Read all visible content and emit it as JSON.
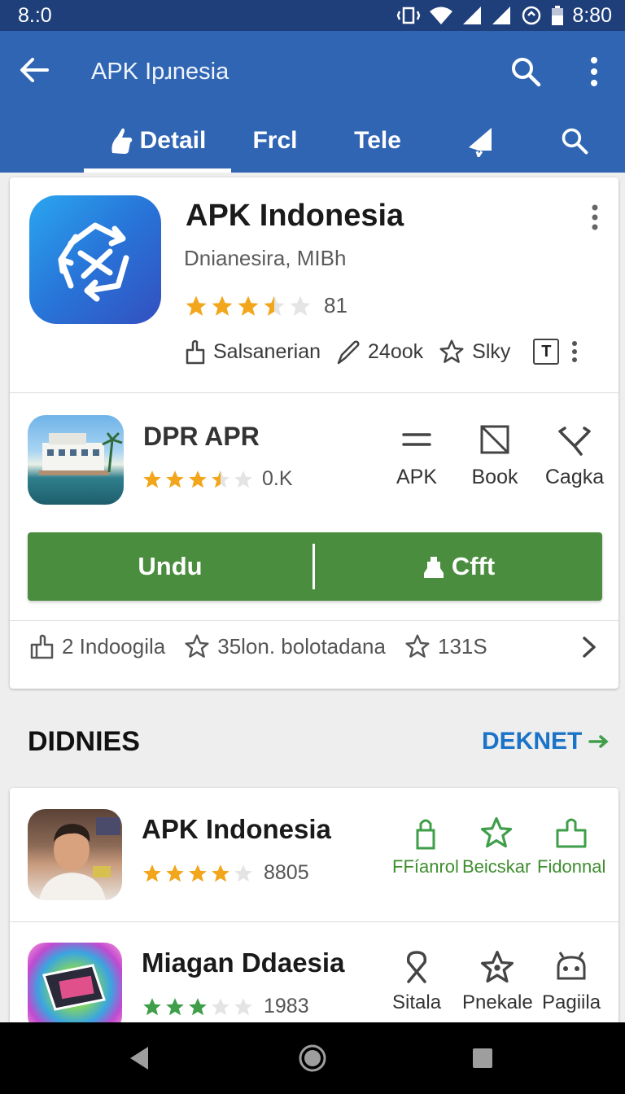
{
  "status_bar": {
    "time_left": "8.:0",
    "time_right": "8:80"
  },
  "app_bar": {
    "title": "APK Ipɹnesia"
  },
  "tabs": [
    {
      "label": "Detail",
      "active": true
    },
    {
      "label": "Frcl",
      "active": false
    },
    {
      "label": "Tele",
      "active": false
    },
    {
      "icon": "notification-icon"
    },
    {
      "icon": "search-icon"
    }
  ],
  "main_app": {
    "title": "APK Indonesia",
    "subtitle": "Dnianesira, MIBh",
    "rating": 3.5,
    "rating_count": "81",
    "meta": [
      {
        "icon": "thumb-icon",
        "label": "Salsanerian"
      },
      {
        "icon": "pen-icon",
        "label": "24ook"
      },
      {
        "icon": "star-outline-icon",
        "label": "Slky"
      },
      {
        "icon": "text-box-icon",
        "label": "T"
      }
    ]
  },
  "dpr_app": {
    "title": "DPR APR",
    "rating": 3.5,
    "rating_count": "0.K",
    "actions": [
      {
        "icon": "equals-icon",
        "label": "APK"
      },
      {
        "icon": "book-icon",
        "label": "Book"
      },
      {
        "icon": "tools-icon",
        "label": "Cagka"
      }
    ]
  },
  "cta": {
    "primary": "Undu",
    "secondary": "Cfft"
  },
  "stats": [
    {
      "icon": "thumb-icon",
      "label": "2 Indoogila"
    },
    {
      "icon": "star-outline-icon",
      "label": "35lon. bolotadana"
    },
    {
      "icon": "star-outline-icon",
      "label": "131S"
    }
  ],
  "section": {
    "title": "DIDNIES",
    "link": "DEKNET"
  },
  "list": [
    {
      "title": "APK Indonesia",
      "rating": 4,
      "rating_count": "8805",
      "actions": [
        {
          "icon": "lock-icon",
          "label": "FFíanrol"
        },
        {
          "icon": "star-outline-icon",
          "label": "Beicskar"
        },
        {
          "icon": "thumb-icon",
          "label": "Fidonnal"
        }
      ]
    },
    {
      "title": "Miagan Ddaesia",
      "rating": 3,
      "rating_count": "1983",
      "actions": [
        {
          "icon": "ribbon-icon",
          "label": "Sitala"
        },
        {
          "icon": "star-badge-icon",
          "label": "Pnekale"
        },
        {
          "icon": "robot-icon",
          "label": "Pagiila"
        }
      ]
    }
  ],
  "colors": {
    "status_bar": "#1f3f7a",
    "app_bar": "#2f65b3",
    "cta": "#4b8d3f",
    "star": "#f2a61c",
    "star_green": "#3e9e4a",
    "link": "#1a73c8"
  }
}
